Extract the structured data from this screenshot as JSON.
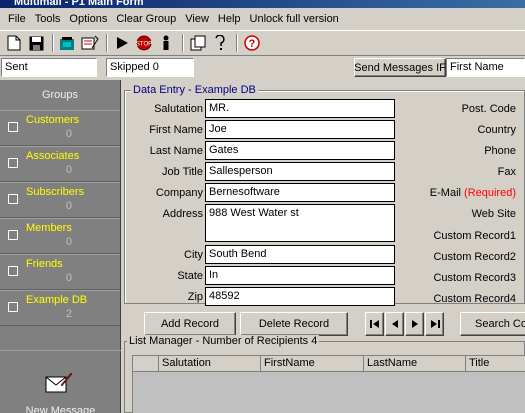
{
  "window": {
    "title": "Multimail - P1 Main Form"
  },
  "menu": [
    "File",
    "Tools",
    "Options",
    "Clear Group",
    "View",
    "Help",
    "Unlock full version"
  ],
  "toolbar_icons": [
    "new-file-icon",
    "save-icon",
    "open-folder-icon",
    "attach-icon",
    "send-arrow-icon",
    "stop-icon",
    "person-icon",
    "copy-icon",
    "help-tip-icon",
    "about-icon"
  ],
  "status": {
    "sent_label": "Sent",
    "skipped_label": "Skipped 0",
    "send_if_label": "Send Messages IF",
    "send_if_field": "First Name"
  },
  "sidebar": {
    "header": "Groups",
    "groups": [
      {
        "name": "Customers",
        "count": "0"
      },
      {
        "name": "Associates",
        "count": "0"
      },
      {
        "name": "Subscribers",
        "count": "0"
      },
      {
        "name": "Members",
        "count": "0"
      },
      {
        "name": "Friends",
        "count": "0"
      },
      {
        "name": "Example DB",
        "count": "2"
      }
    ],
    "new_message_label": "New Message"
  },
  "data_entry": {
    "legend": "Data Entry - Example DB",
    "fields": {
      "salutation": {
        "label": "Salutation",
        "value": "MR."
      },
      "first_name": {
        "label": "First Name",
        "value": "Joe"
      },
      "last_name": {
        "label": "Last Name",
        "value": "Gates"
      },
      "job_title": {
        "label": "Job Title",
        "value": "Sallesperson"
      },
      "company": {
        "label": "Company",
        "value": "Bernesoftware"
      },
      "address": {
        "label": "Address",
        "value": "988 West Water st"
      },
      "city": {
        "label": "City",
        "value": "South Bend"
      },
      "state": {
        "label": "State",
        "value": "In"
      },
      "zip": {
        "label": "Zip",
        "value": "48592"
      }
    },
    "right_labels": {
      "post_code": "Post. Code",
      "country": "Country",
      "phone": "Phone",
      "fax": "Fax",
      "email": "E-Mail",
      "email_required": "(Required)",
      "web_site": "Web Site",
      "custom1": "Custom Record1",
      "custom2": "Custom Record2",
      "custom3": "Custom Record3",
      "custom4": "Custom Record4"
    }
  },
  "actions": {
    "add_record": "Add Record",
    "delete_record": "Delete Record",
    "search": "Search Co"
  },
  "list_manager": {
    "legend": "List Manager - Number of Recipients 4",
    "columns": [
      "Salutation",
      "FirstName",
      "LastName",
      "Title"
    ]
  },
  "colors": {
    "group_name": "#ffff00",
    "required": "#ff0000",
    "legend_text": "#000080",
    "sidebar_bg": "#808080"
  }
}
